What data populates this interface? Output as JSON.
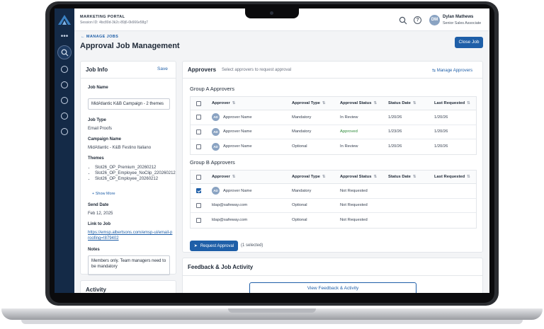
{
  "header": {
    "portal_title": "MARKETING PORTAL",
    "session": "Session ID: 4bc80d-3k2c-89j6-0k666e58g7",
    "avatar_initials": "DM",
    "user_name": "Dylan Mathews",
    "user_role": "Senior Sales Associate"
  },
  "page": {
    "back_link": "MANAGE JOBS",
    "title": "Approval Job Management",
    "close_label": "Close Job"
  },
  "job_info": {
    "title": "Job Info",
    "save_label": "Save",
    "job_name_label": "Job Name",
    "job_name_value": "MidAtlantic K&B Campaign - 2 themes",
    "job_type_label": "Job Type",
    "job_type_value": "Email Proofs",
    "campaign_name_label": "Campaign Name",
    "campaign_name_value": "MidAtlantic - K&B Festino Italiano",
    "themes_label": "Themes",
    "themes": [
      "Slot26_OP_Premium_20260212",
      "Slot26_OP_Employee_NoClip_220260212",
      "Slot26_OP_Employee_20260212"
    ],
    "show_more": "Show More",
    "send_date_label": "Send Date",
    "send_date_value": "Feb 12, 2025",
    "link_label": "Link to Job",
    "link_value": "https://emsp.albertsons.com/emsp-ui/email-proofing=!879402",
    "notes_label": "Notes",
    "notes_value": "Members only. Team managers need to be mandatory"
  },
  "activity": {
    "title": "Activity"
  },
  "approvers": {
    "title": "Approvers",
    "subtitle": "Select approvers to request approval",
    "manage_label": "Manage Approvers",
    "columns": [
      "Approver",
      "Approval Type",
      "Approval Status",
      "Status Date",
      "Last Requested"
    ],
    "group_a": {
      "title": "Group A Approvers",
      "rows": [
        {
          "initials": "AD",
          "approver": "Approver Name",
          "type": "Mandatory",
          "status": "In Review",
          "status_date": "1/20/26",
          "last_requested": "1/20/26",
          "checked": false
        },
        {
          "initials": "AD",
          "approver": "Approver Name",
          "type": "Mandatory",
          "status": "Approved",
          "status_date": "1/23/26",
          "last_requested": "1/20/26",
          "checked": false
        },
        {
          "initials": "AD",
          "approver": "Approver Name",
          "type": "Optional",
          "status": "In Review",
          "status_date": "1/20/26",
          "last_requested": "1/20/26",
          "checked": false
        }
      ]
    },
    "group_b": {
      "title": "Group B Approvers",
      "rows": [
        {
          "initials": "AD",
          "approver": "Approver Name",
          "type": "Mandatory",
          "status": "Not Requested",
          "status_date": "",
          "last_requested": "",
          "checked": true
        },
        {
          "initials": "",
          "approver": "ldap@safeway.com",
          "type": "Optional",
          "status": "Not Requested",
          "status_date": "",
          "last_requested": "",
          "checked": false
        },
        {
          "initials": "",
          "approver": "ldap@safeway.com",
          "type": "Optional",
          "status": "Not Requested",
          "status_date": "",
          "last_requested": "",
          "checked": false
        }
      ]
    },
    "request_label": "Request Approval",
    "selected_count": "(1 selected)"
  },
  "feedback": {
    "title": "Feedback & Job Activity",
    "view_label": "View Feedback & Activity"
  },
  "colors": {
    "brand": "#1f5fa8",
    "sidebar": "#142a47",
    "approved": "#2e8b3a"
  }
}
